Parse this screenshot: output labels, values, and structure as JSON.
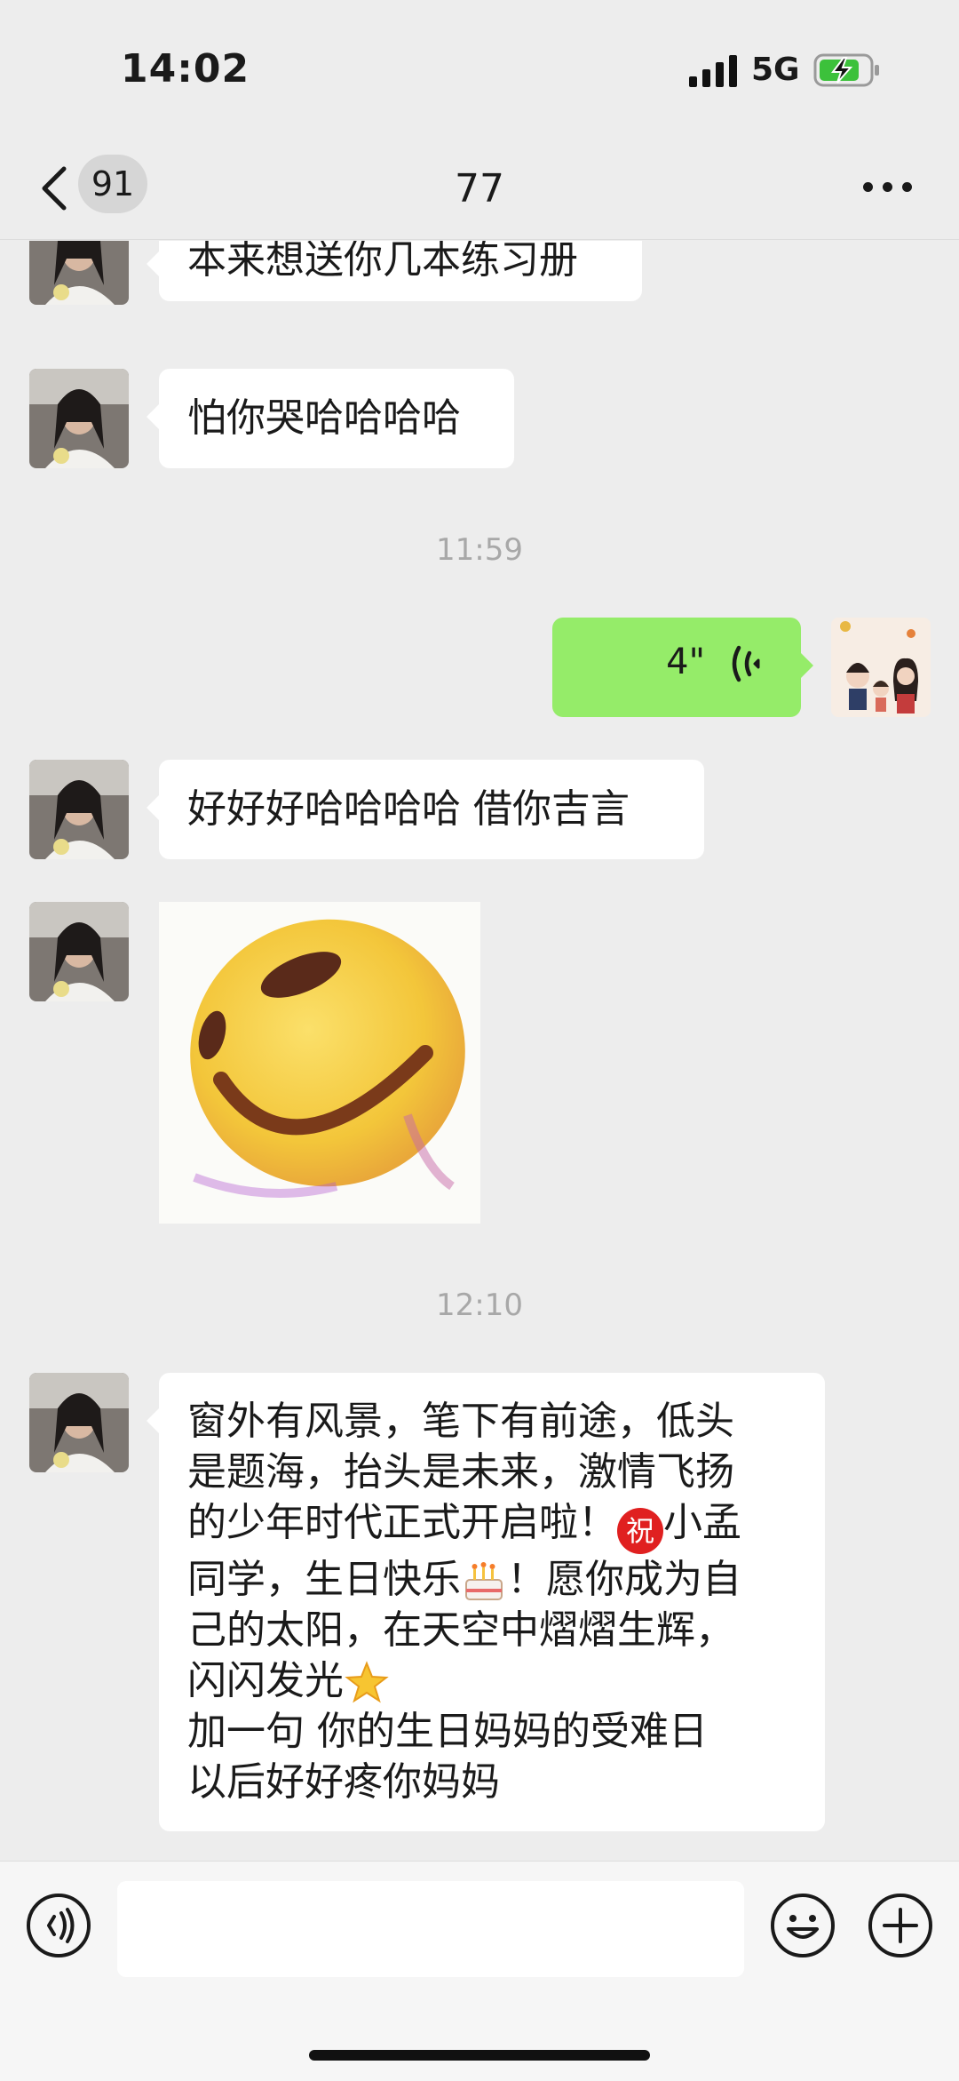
{
  "status_bar": {
    "time": "14:02",
    "network": "5G",
    "battery": "charging"
  },
  "header": {
    "back_label": "<",
    "unread_count": "91",
    "title": "77",
    "more": "···"
  },
  "messages": {
    "m1": {
      "side": "left",
      "text": "本来想送你几本练习册"
    },
    "m2": {
      "side": "left",
      "text": "怕你哭哈哈哈哈"
    },
    "t1": "11:59",
    "m3": {
      "side": "right",
      "type": "voice",
      "duration": "4\""
    },
    "m4": {
      "side": "left",
      "text": "好好好哈哈哈哈 借你吉言"
    },
    "m5": {
      "side": "left",
      "type": "sticker",
      "sticker": "laughing-smiley-sticker"
    },
    "t2": "12:10",
    "m6": {
      "side": "left",
      "line1": "窗外有风景，笔下有前途，低头",
      "line2": "是题海，抬头是未来，激情飞扬",
      "line3a": "的少年时代正式开启啦！",
      "zhu": "祝",
      "line3b": "小孟",
      "line4a": "同学，生日快乐",
      "line4b": "！愿你成为自",
      "line5": "己的太阳，在天空中熠熠生辉，",
      "line6": "闪闪发光",
      "line7": "加一句 你的生日妈妈的受难日",
      "line8": "以后好好疼你妈妈"
    }
  },
  "input_bar": {
    "placeholder": ""
  },
  "colors": {
    "my_bubble": "#95ec69",
    "their_bubble": "#ffffff",
    "background": "#ededed"
  }
}
